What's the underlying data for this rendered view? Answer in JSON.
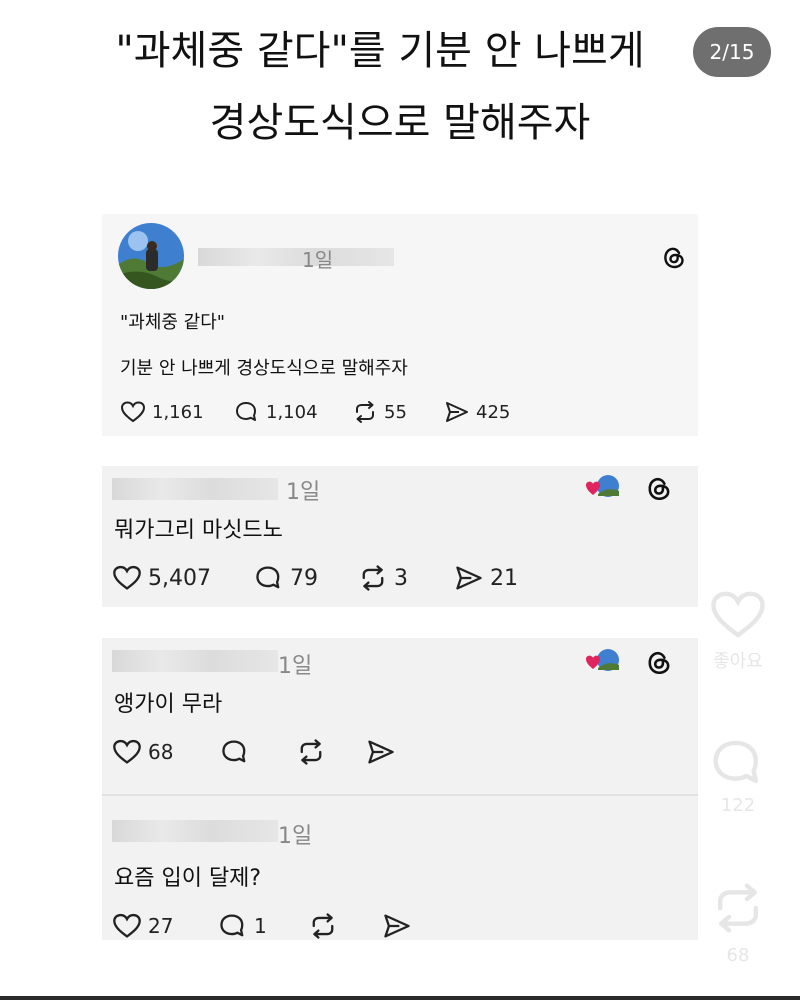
{
  "title": {
    "line1": "\"과체중 같다\"를 기분 안 나쁘게",
    "line2": "경상도식으로 말해주자",
    "page_indicator": "2/15"
  },
  "post": {
    "time": "1일",
    "quote": "\"과체중 같다\"",
    "body": "기분 안 나쁘게  경상도식으로 말해주자",
    "likes": "1,161",
    "comments": "1,104",
    "reposts": "55",
    "shares": "425"
  },
  "reply1": {
    "time": "1일",
    "text": "뭐가그리 마싯드노",
    "likes": "5,407",
    "comments": "79",
    "reposts": "3",
    "shares": "21"
  },
  "reply2": {
    "time": "1일",
    "text": "앵가이 무라",
    "likes": "68"
  },
  "reply3": {
    "time": "1일",
    "text": "요즘 입이 달제?",
    "likes": "27",
    "comments": "1"
  },
  "sidebar": {
    "like_label": "좋아요",
    "comment_count": "122",
    "repost_count": "68"
  },
  "colors": {
    "card_bg": "#f2f2f2",
    "pill_bg": "#6f6f6f",
    "heart_red": "#e0245e",
    "side_icon": "#e6e6e6"
  }
}
